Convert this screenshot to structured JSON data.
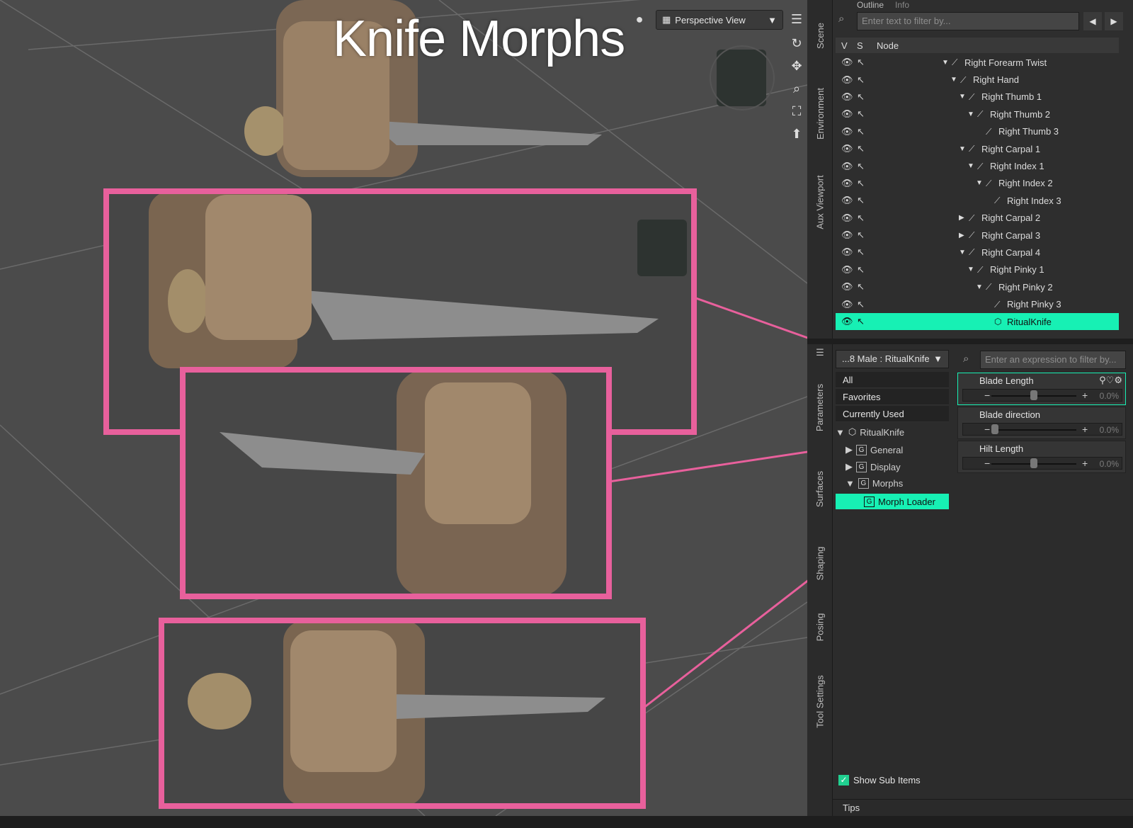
{
  "viewport": {
    "title": "Knife Morphs",
    "view_label": "Perspective View"
  },
  "side_tabs_top": [
    "Scene",
    "Environment",
    "Aux Viewport"
  ],
  "side_tabs_bottom": [
    "Parameters",
    "Surfaces",
    "Shaping",
    "Posing",
    "Tool Settings"
  ],
  "outline": {
    "tab_label": "Outline",
    "info_label": "Info",
    "filter_placeholder": "Enter text to filter by...",
    "col_v": "V",
    "col_s": "S",
    "col_node": "Node",
    "nodes": [
      {
        "label": "Right Forearm Twist",
        "depth": 0,
        "arrow": "▼"
      },
      {
        "label": "Right Hand",
        "depth": 1,
        "arrow": "▼"
      },
      {
        "label": "Right Thumb 1",
        "depth": 2,
        "arrow": "▼"
      },
      {
        "label": "Right Thumb 2",
        "depth": 3,
        "arrow": "▼"
      },
      {
        "label": "Right Thumb 3",
        "depth": 4,
        "arrow": ""
      },
      {
        "label": "Right Carpal 1",
        "depth": 2,
        "arrow": "▼"
      },
      {
        "label": "Right Index 1",
        "depth": 3,
        "arrow": "▼"
      },
      {
        "label": "Right Index 2",
        "depth": 4,
        "arrow": "▼"
      },
      {
        "label": "Right Index 3",
        "depth": 5,
        "arrow": ""
      },
      {
        "label": "Right Carpal 2",
        "depth": 2,
        "arrow": "▶"
      },
      {
        "label": "Right Carpal 3",
        "depth": 2,
        "arrow": "▶"
      },
      {
        "label": "Right Carpal 4",
        "depth": 2,
        "arrow": "▼"
      },
      {
        "label": "Right Pinky 1",
        "depth": 3,
        "arrow": "▼"
      },
      {
        "label": "Right Pinky 2",
        "depth": 4,
        "arrow": "▼"
      },
      {
        "label": "Right Pinky 3",
        "depth": 5,
        "arrow": ""
      },
      {
        "label": "RitualKnife",
        "depth": 2,
        "arrow": "",
        "selected": true
      }
    ]
  },
  "parameters": {
    "node_dropdown": "...8 Male : RitualKnife",
    "filter_placeholder": "Enter an expression to filter by...",
    "categories": [
      {
        "label": "All"
      },
      {
        "label": "Favorites"
      },
      {
        "label": "Currently Used"
      }
    ],
    "tree": {
      "root": "RitualKnife",
      "groups": [
        "General",
        "Display",
        "Morphs"
      ],
      "subgroup": "Morph Loader"
    },
    "sliders": [
      {
        "name": "Blade Length",
        "value": "0.0%",
        "fill": 0.5
      },
      {
        "name": "Blade direction",
        "value": "0.0%",
        "fill": 0.0
      },
      {
        "name": "Hilt Length",
        "value": "0.0%",
        "fill": 0.5
      }
    ],
    "show_sub_items": "Show Sub Items",
    "tips_label": "Tips"
  },
  "colors": {
    "selection": "#17f0b4",
    "callout": "#e8609c"
  }
}
